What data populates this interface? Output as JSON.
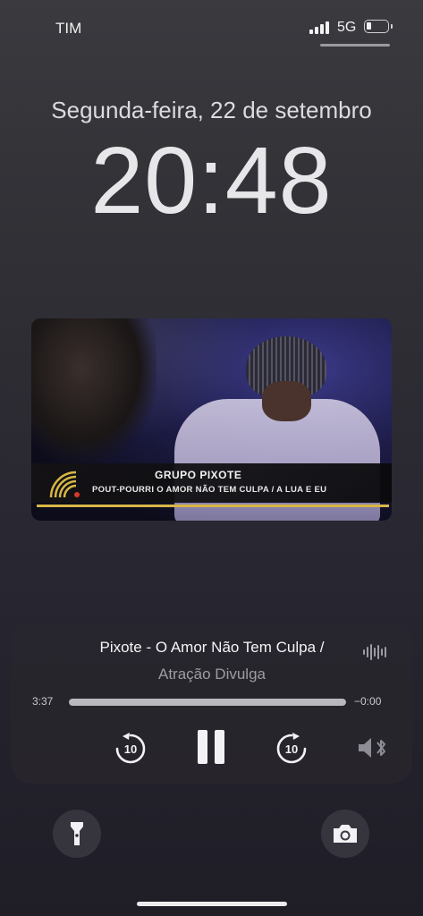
{
  "status_bar": {
    "carrier": "TIM",
    "network": "5G",
    "signal_bars": 4,
    "battery_level_percent": 20
  },
  "lock_screen": {
    "date": "Segunda-feira, 22 de setembro",
    "time": "20:48"
  },
  "artwork": {
    "lower_third_title": "GRUPO PIXOTE",
    "lower_third_subtitle": "POUT-POURRI O AMOR NÃO TEM CULPA / A LUA E EU"
  },
  "now_playing": {
    "title": "Pixote - O Amor Não Tem Culpa /",
    "artist": "Atração Divulga",
    "elapsed": "3:37",
    "remaining": "−0:00",
    "progress_fraction": 1.0,
    "skip_seconds": "10"
  },
  "icons": {
    "waveform": "waveform-icon",
    "skip_back": "skip-back-10-icon",
    "pause": "pause-icon",
    "skip_forward": "skip-forward-10-icon",
    "airplay": "speaker-bluetooth-icon",
    "flashlight": "flashlight-icon",
    "camera": "camera-icon"
  },
  "colors": {
    "lower_third_accent": "#d7b645",
    "text_secondary": "#9c9ba3"
  }
}
